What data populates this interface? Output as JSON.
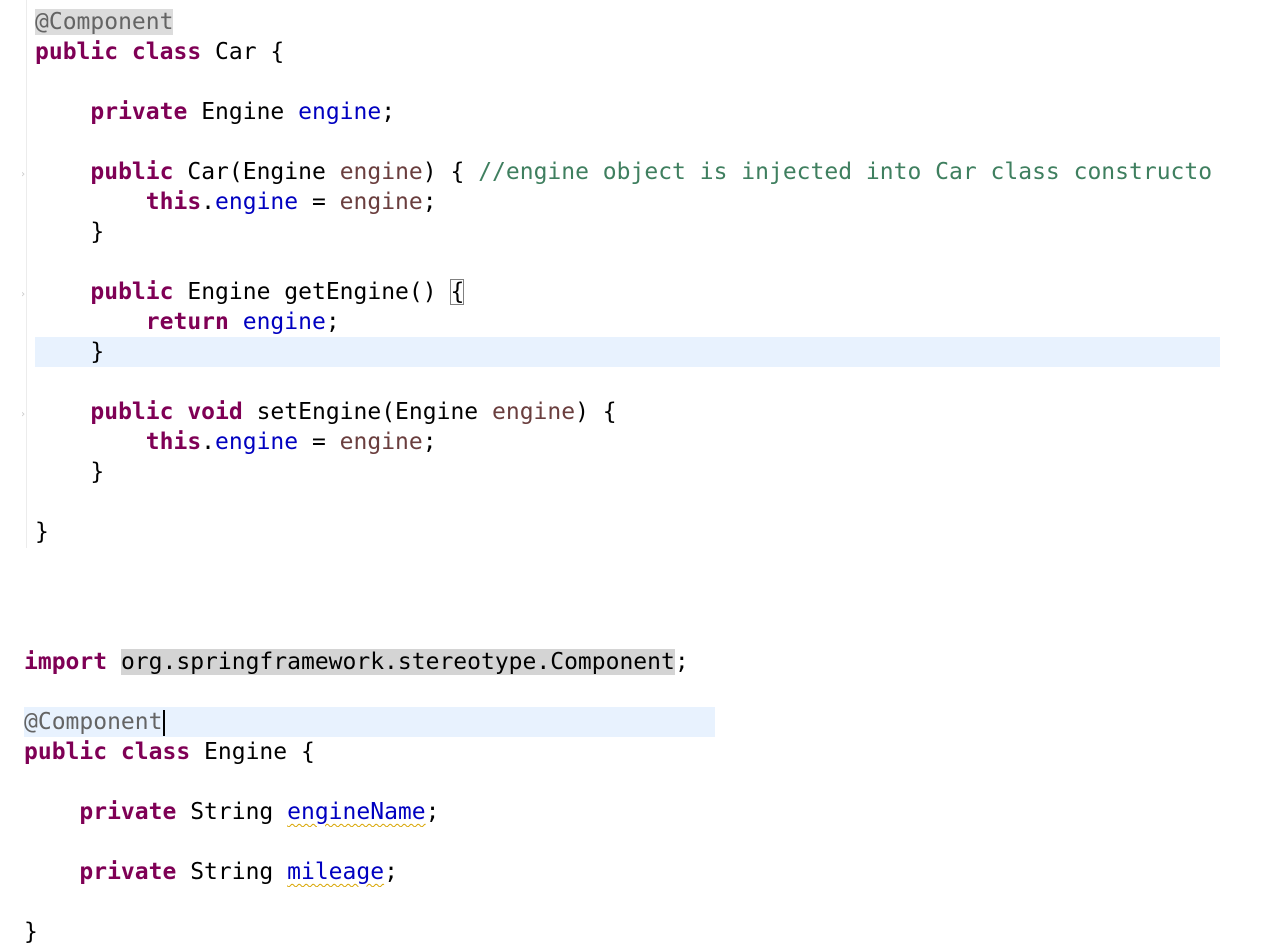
{
  "car_class": {
    "annotation": "@Component",
    "class_keywords": "public class",
    "class_name": "Car {",
    "field_keyword": "private",
    "field_type": "Engine",
    "field_name": "engine",
    "semicolon": ";",
    "constructor": {
      "keyword": "public",
      "signature_start": "Car(Engine",
      "param": "engine",
      "signature_end": ") {",
      "comment": "//engine object is injected into Car class constructo"
    },
    "this_keyword": "this",
    "dot": ".",
    "assign": " = ",
    "close_brace": "}",
    "getter": {
      "keyword": "public",
      "signature": "Engine getEngine()",
      "open_brace": "{",
      "return_keyword": "return"
    },
    "setter": {
      "keywords": "public void",
      "signature_start": "setEngine(Engine",
      "param": "engine",
      "signature_end": ") {"
    }
  },
  "engine_class": {
    "import_keyword": "import",
    "import_path": "org.springframework.stereotype.Component",
    "semicolon": ";",
    "annotation": "@Component",
    "class_keywords": "public class",
    "class_name": "Engine {",
    "field_keyword": "private",
    "field_type": "String",
    "field1_name": "engineName",
    "field2_name": "mileage",
    "close_brace": "}"
  },
  "colors": {
    "keyword": "#7f0055",
    "field": "#0000c0",
    "parameter": "#6a3e3e",
    "comment": "#3f7f5f",
    "annotation": "#646464",
    "current_line": "#e8f2fe",
    "warning_squiggle": "#d7a400"
  }
}
